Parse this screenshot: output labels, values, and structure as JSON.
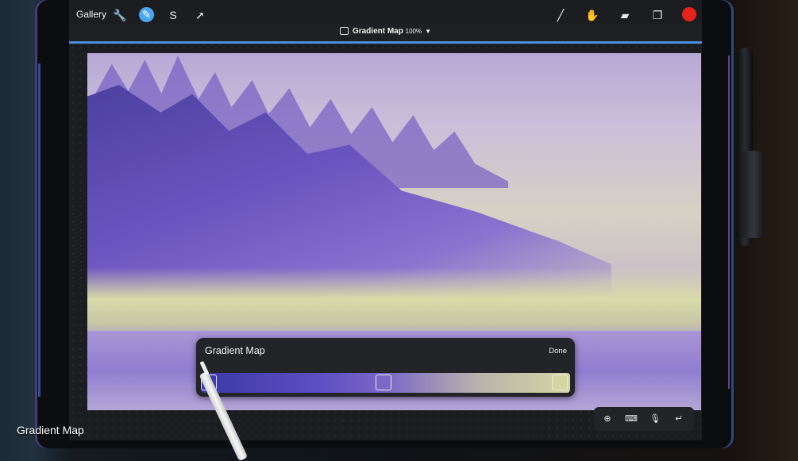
{
  "toolbar": {
    "gallery_label": "Gallery",
    "icons": [
      "wrench-icon",
      "magic-wand-icon",
      "selection-icon",
      "transform-arrow-icon",
      "brush-icon",
      "smudge-icon",
      "eraser-icon",
      "layers-icon"
    ],
    "active_color": "#e8231c",
    "accent_color": "#4a90e2"
  },
  "adjustment": {
    "name": "Gradient Map",
    "opacity": "100%"
  },
  "gradient_panel": {
    "title": "Gradient Map",
    "done_label": "Done",
    "gradient_colors": [
      "#3b3aa6",
      "#7a67c6",
      "#d5d5a2"
    ]
  },
  "quick_bar": {
    "icons": [
      "cursor-icon",
      "keyboard-icon",
      "microphone-icon",
      "return-icon"
    ]
  },
  "caption": "Gradient Map"
}
